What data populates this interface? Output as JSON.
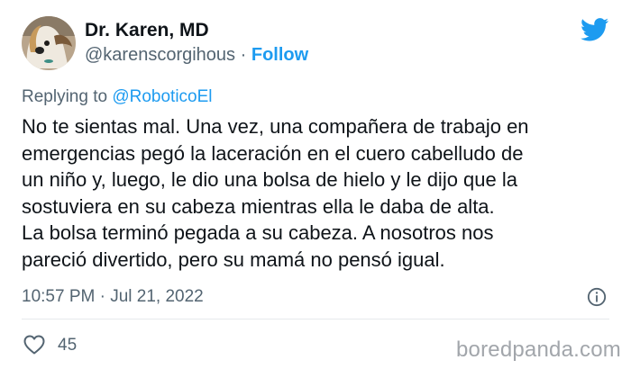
{
  "author": {
    "name": "Dr. Karen, MD",
    "handle": "@karenscorgihous",
    "separator": "·",
    "follow_label": "Follow",
    "avatar_icon": "corgi-avatar"
  },
  "reply": {
    "prefix": "Replying to ",
    "mention": "@RoboticoEl"
  },
  "tweet": {
    "lines": [
      "No te sientas mal. Una vez, una compañera de trabajo en",
      "emergencias pegó la laceración en el cuero cabelludo de",
      "un niño y, luego, le dio una bolsa de hielo y le dijo que la",
      "sostuviera en su cabeza mientras ella le daba de alta.",
      "La bolsa terminó pegada a su cabeza. A nosotros nos",
      "pareció divertido, pero su mamá no pensó igual."
    ]
  },
  "meta": {
    "time": "10:57 PM",
    "separator": "·",
    "date": "Jul 21, 2022"
  },
  "stats": {
    "likes": "45"
  },
  "watermark": "boredpanda.com",
  "colors": {
    "twitter_blue": "#1d9bf0",
    "text_primary": "#0f1419",
    "text_secondary": "#536471"
  }
}
